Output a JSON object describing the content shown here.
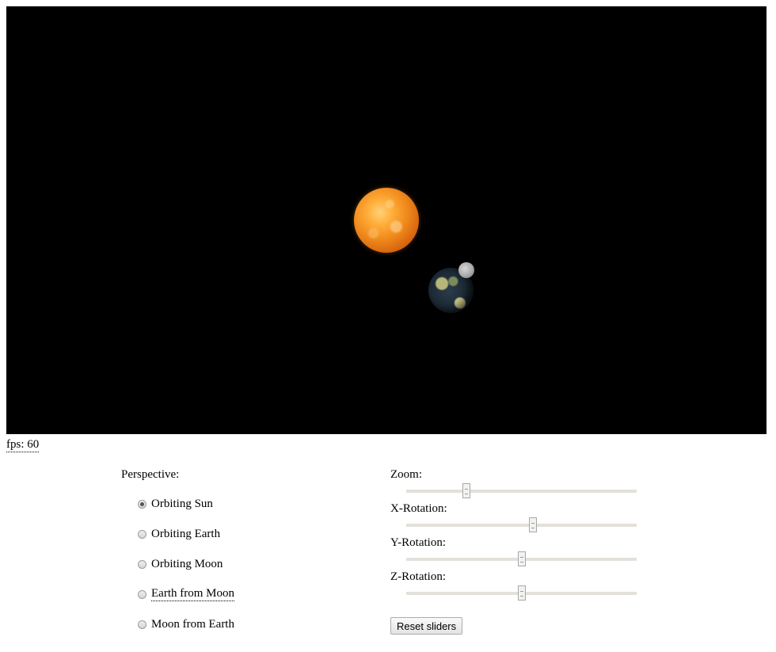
{
  "fps": {
    "label": "fps: 60"
  },
  "perspective": {
    "heading": "Perspective:",
    "options": [
      {
        "label": "Orbiting Sun",
        "checked": true
      },
      {
        "label": "Orbiting Earth",
        "checked": false
      },
      {
        "label": "Orbiting Moon",
        "checked": false
      },
      {
        "label": "Earth from Moon",
        "checked": false
      },
      {
        "label": "Moon from Earth",
        "checked": false
      }
    ]
  },
  "sliders": [
    {
      "label": "Zoom:",
      "value": 0.26
    },
    {
      "label": "X-Rotation:",
      "value": 0.55
    },
    {
      "label": "Y-Rotation:",
      "value": 0.5
    },
    {
      "label": "Z-Rotation:",
      "value": 0.5
    }
  ],
  "reset_button": {
    "label": "Reset sliders"
  },
  "scene": {
    "bodies": [
      "sun",
      "earth",
      "moon"
    ],
    "background_color": "#000000",
    "sun_color": "#f08a1c"
  }
}
